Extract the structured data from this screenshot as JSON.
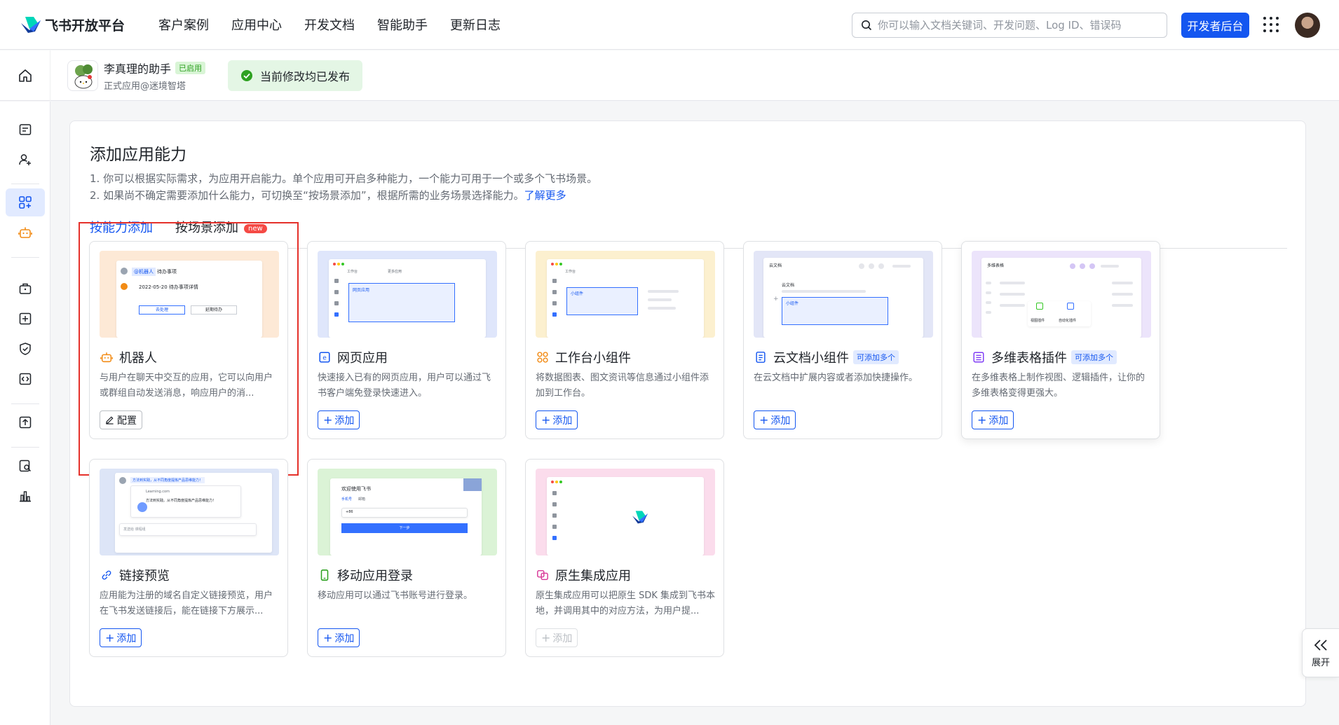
{
  "topbar": {
    "brand": "飞书开放平台",
    "nav": [
      "客户案例",
      "应用中心",
      "开发文档",
      "智能助手",
      "更新日志"
    ],
    "search_placeholder": "你可以输入文档关键词、开发问题、Log ID、错误码",
    "dev_console": "开发者后台"
  },
  "app": {
    "name": "李真理的助手",
    "status_badge": "已启用",
    "subtitle": "正式应用@迷境智塔",
    "publish_status": "当前修改均已发布"
  },
  "main": {
    "title": "添加应用能力",
    "desc_1": "1. 你可以根据实际需求，为应用开启能力。单个应用可开启多种能力，一个能力可用于一个或多个飞书场景。",
    "desc_2": "2. 如果尚不确定需要添加什么能力，可切换至“按场景添加”，根据所需的业务场景选择能力。",
    "learn_more": "了解更多",
    "tabs": [
      {
        "label": "按能力添加",
        "active": true
      },
      {
        "label": "按场景添加",
        "badge": "new"
      }
    ]
  },
  "cards": [
    {
      "title": "机器人",
      "icon": "robot-icon",
      "desc": "与用户在聊天中交互的应用，它可以向用户或群组自动发送消息，响应用户的消...",
      "button": "配置",
      "button_type": "config",
      "mock": {
        "tag": "@机器人",
        "tag2": "待办事项",
        "line": "2022-05-20 待办事项详情",
        "btn_a": "去处理",
        "btn_b": "延期待办"
      }
    },
    {
      "title": "网页应用",
      "icon": "web-app-icon",
      "desc": "快速接入已有的网页应用，用户可以通过飞书客户端免登录快速进入。",
      "button": "添加",
      "button_type": "add",
      "mock": {
        "tab1": "工作台",
        "tab2": "更多应用",
        "label": "网页应用"
      }
    },
    {
      "title": "工作台小组件",
      "icon": "widget-icon",
      "desc": "将数据图表、图文资讯等信息通过小组件添加到工作台。",
      "button": "添加",
      "button_type": "add",
      "mock": {
        "tab1": "工作台",
        "label": "小组件"
      }
    },
    {
      "title": "云文档小组件",
      "icon": "doc-widget-icon",
      "badge": "可添加多个",
      "desc": "在云文档中扩展内容或者添加快捷操作。",
      "button": "添加",
      "button_type": "add",
      "mock": {
        "back": "云文档",
        "heading": "云文档",
        "label": "小组件"
      }
    },
    {
      "title": "多维表格插件",
      "icon": "bitable-icon",
      "badge": "可添加多个",
      "desc": "在多维表格上制作视图、逻辑插件，让你的多维表格变得更强大。",
      "button": "添加",
      "button_type": "add",
      "mock": {
        "back": "多维表格",
        "plugin1": "视图插件",
        "plugin2": "自动化插件"
      }
    },
    {
      "title": "链接预览",
      "icon": "link-icon",
      "desc": "应用能为注册的域名自定义链接预览，用户在飞书发送链接后，能在链接下方展示...",
      "button": "添加",
      "button_type": "add",
      "mock": {
        "msg": "方法到实践，从不同角度提炼产品思维能力！",
        "site": "Learning.com",
        "preview": "方法到实践。从不同角度提炼产品思维能力！",
        "input": "发送给 课程组"
      }
    },
    {
      "title": "移动应用登录",
      "icon": "mobile-icon",
      "desc": "移动应用可以通过飞书账号进行登录。",
      "button": "添加",
      "button_type": "add",
      "mock": {
        "welcome": "欢迎使用飞书",
        "tab1": "手机号",
        "tab2": "邮箱",
        "code": "+86",
        "next": "下一步"
      }
    },
    {
      "title": "原生集成应用",
      "icon": "native-app-icon",
      "desc": "原生集成应用可以把原生 SDK 集成到飞书本地，并调用其中的对应方法，为用户提...",
      "button": "添加",
      "button_type": "disabled",
      "mock": {}
    }
  ],
  "expand": {
    "label": "展开"
  },
  "colors": {
    "primary": "#1456f0",
    "success": "#2ea121",
    "danger": "#e5312b"
  }
}
